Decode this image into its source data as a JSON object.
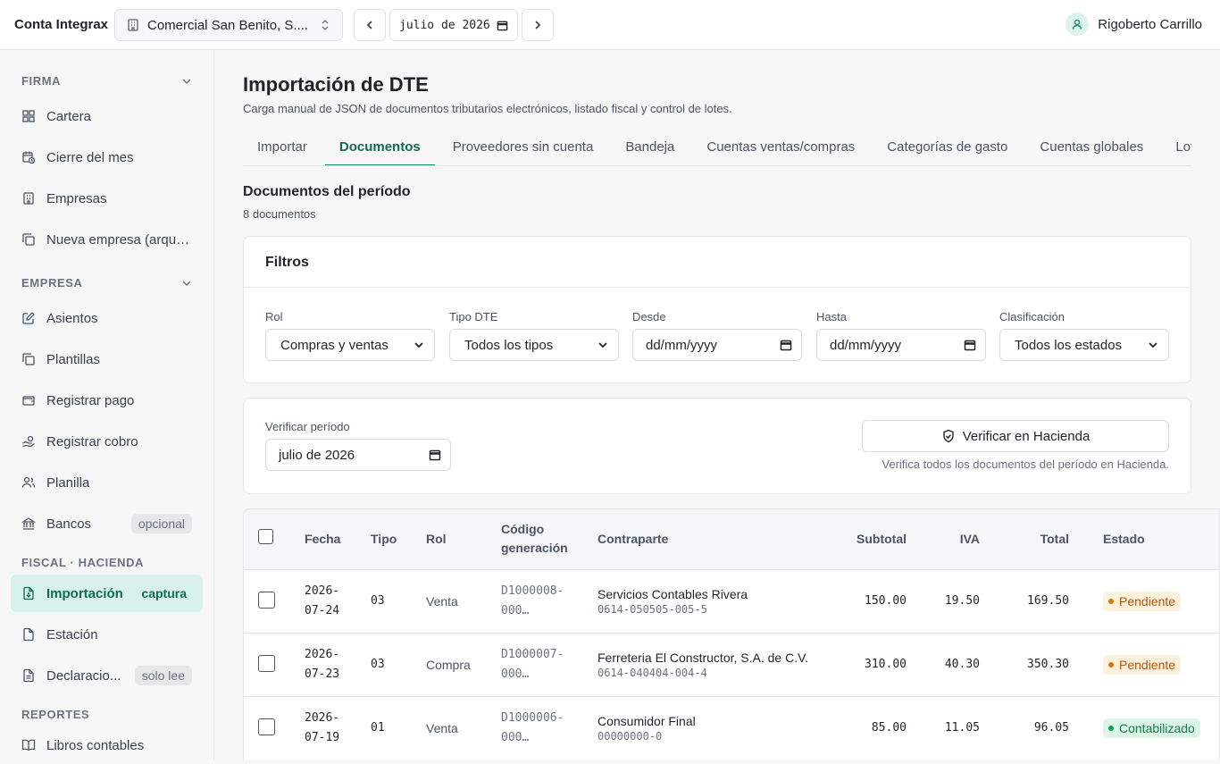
{
  "app": {
    "title": "Conta Integrax"
  },
  "topbar": {
    "company": "Comercial San Benito, S....",
    "period": "julio de 2026",
    "user": "Rigoberto Carrillo"
  },
  "sidebar": {
    "sections": [
      {
        "title": "FIRMA",
        "collapsible": true
      },
      {
        "title": "EMPRESA",
        "collapsible": true
      },
      {
        "title": "FISCAL · HACIENDA",
        "collapsible": false
      },
      {
        "title": "REPORTES",
        "collapsible": false
      }
    ],
    "items": [
      {
        "label": "Cartera",
        "icon": "grid-icon"
      },
      {
        "label": "Cierre del mes",
        "icon": "calendar-clock-icon"
      },
      {
        "label": "Empresas",
        "icon": "building-icon"
      },
      {
        "label": "Nueva empresa (arque...",
        "icon": "copy-icon"
      },
      {
        "label": "Asientos",
        "icon": "edit-icon"
      },
      {
        "label": "Plantillas",
        "icon": "copy-icon"
      },
      {
        "label": "Registrar pago",
        "icon": "wallet-icon"
      },
      {
        "label": "Registrar cobro",
        "icon": "hand-coins-icon"
      },
      {
        "label": "Planilla",
        "icon": "users-icon"
      },
      {
        "label": "Bancos",
        "icon": "bank-icon",
        "badge": "opcional"
      },
      {
        "label": "Importación",
        "icon": "file-import-icon",
        "badge": "captura",
        "active": true
      },
      {
        "label": "Estación",
        "icon": "file-icon"
      },
      {
        "label": "Declaracio...",
        "icon": "file-text-icon",
        "badge": "solo lee"
      },
      {
        "label": "Libros contables",
        "icon": "book-icon"
      }
    ]
  },
  "page": {
    "title": "Importación de DTE",
    "subtitle": "Carga manual de JSON de documentos tributarios electrónicos, listado fiscal y control de lotes.",
    "tabs": [
      "Importar",
      "Documentos",
      "Proveedores sin cuenta",
      "Bandeja",
      "Cuentas ventas/compras",
      "Categorías de gasto",
      "Cuentas globales",
      "Lote"
    ],
    "active_tab": "Documentos",
    "docs_title": "Documentos del período",
    "docs_count": "8 documentos"
  },
  "filters": {
    "title": "Filtros",
    "rol": {
      "label": "Rol",
      "value": "Compras y ventas"
    },
    "tipo": {
      "label": "Tipo DTE",
      "value": "Todos los tipos"
    },
    "desde": {
      "label": "Desde",
      "value": "dd/mm/yyyy"
    },
    "hasta": {
      "label": "Hasta",
      "value": "dd/mm/yyyy"
    },
    "clasificacion": {
      "label": "Clasificación",
      "value": "Todos los estados"
    }
  },
  "verify": {
    "label": "Verificar período",
    "value": "julio de 2026",
    "button": "Verificar en Hacienda",
    "hint": "Verifica todos los documentos del período en Hacienda."
  },
  "table": {
    "headers": {
      "fecha": "Fecha",
      "tipo": "Tipo",
      "rol": "Rol",
      "codigo_1": "Código",
      "codigo_2": "generación",
      "contraparte": "Contraparte",
      "subtotal": "Subtotal",
      "iva": "IVA",
      "total": "Total",
      "estado": "Estado"
    },
    "rows": [
      {
        "fecha_1": "2026-",
        "fecha_2": "07-24",
        "tipo": "03",
        "rol": "Venta",
        "codigo_1": "D1000008-",
        "codigo_2": "000…",
        "contraparte": "Servicios Contables Rivera",
        "nit": "0614-050505-005-5",
        "subtotal": "150.00",
        "iva": "19.50",
        "total": "169.50",
        "estado": "Pendiente",
        "estado_kind": "pend"
      },
      {
        "fecha_1": "2026-",
        "fecha_2": "07-23",
        "tipo": "03",
        "rol": "Compra",
        "codigo_1": "D1000007-",
        "codigo_2": "000…",
        "contraparte": "Ferreteria El Constructor, S.A. de C.V.",
        "nit": "0614-040404-004-4",
        "subtotal": "310.00",
        "iva": "40.30",
        "total": "350.30",
        "estado": "Pendiente",
        "estado_kind": "pend"
      },
      {
        "fecha_1": "2026-",
        "fecha_2": "07-19",
        "tipo": "01",
        "rol": "Venta",
        "codigo_1": "D1000006-",
        "codigo_2": "000…",
        "contraparte": "Consumidor Final",
        "nit": "00000000-0",
        "subtotal": "85.00",
        "iva": "11.05",
        "total": "96.05",
        "estado": "Contabilizado",
        "estado_kind": "cont"
      }
    ]
  },
  "colors": {
    "accent": "#0f8a6e",
    "accent_bg": "#d8f1ea",
    "pending": "#b45309",
    "posted": "#157f46"
  }
}
